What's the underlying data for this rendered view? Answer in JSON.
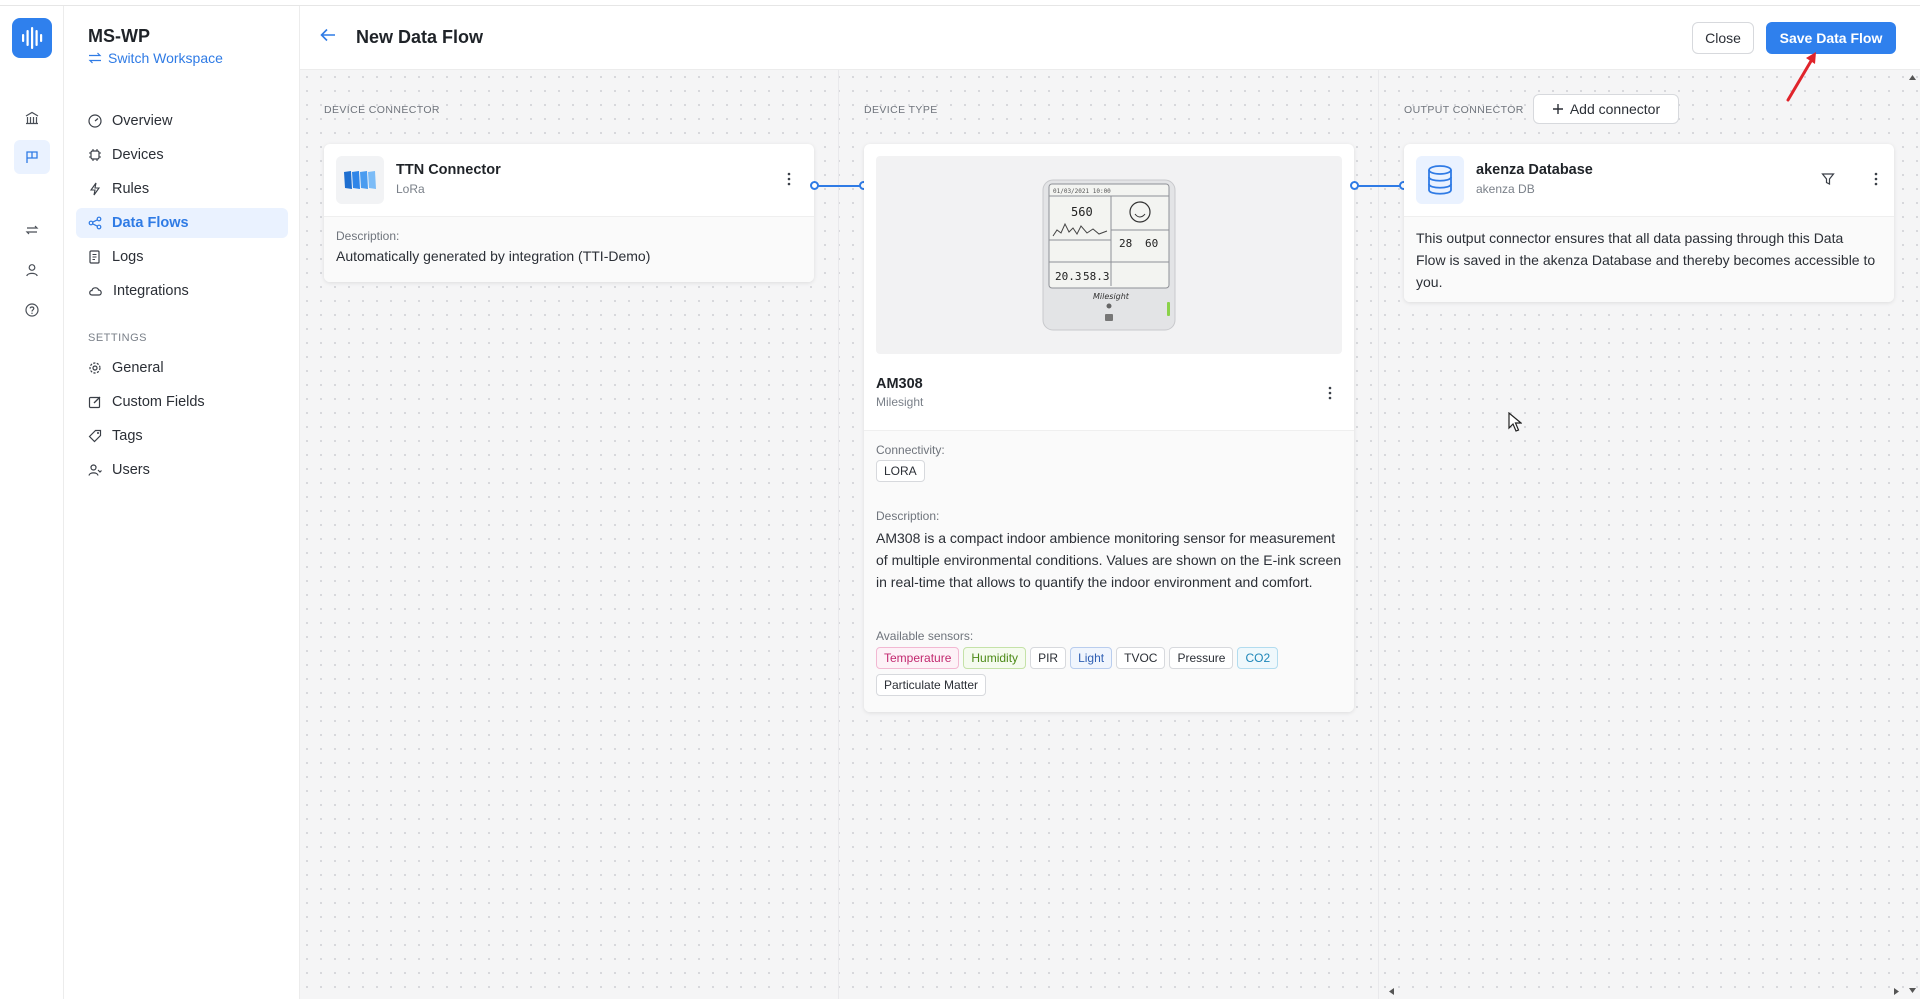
{
  "workspace": {
    "name": "MS-WP",
    "switch_label": "Switch Workspace"
  },
  "nav": {
    "items": [
      {
        "label": "Overview",
        "icon": "gauge-icon"
      },
      {
        "label": "Devices",
        "icon": "chip-icon"
      },
      {
        "label": "Rules",
        "icon": "bolt-icon"
      },
      {
        "label": "Data Flows",
        "icon": "share-icon",
        "active": true
      },
      {
        "label": "Logs",
        "icon": "log-icon"
      },
      {
        "label": "Integrations",
        "icon": "cloud-icon"
      }
    ],
    "settings_title": "SETTINGS",
    "settings_items": [
      {
        "label": "General",
        "icon": "gear-icon"
      },
      {
        "label": "Custom Fields",
        "icon": "edit-icon"
      },
      {
        "label": "Tags",
        "icon": "tag-icon"
      },
      {
        "label": "Users",
        "icon": "users-icon"
      }
    ]
  },
  "header": {
    "title": "New Data Flow",
    "close_label": "Close",
    "save_label": "Save Data Flow"
  },
  "columns": {
    "device_connector": "DEVICE CONNECTOR",
    "device_type": "DEVICE TYPE",
    "output_connector": "OUTPUT CONNECTOR",
    "add_connector_label": "Add connector"
  },
  "ttn_card": {
    "title": "TTN Connector",
    "subtitle": "LoRa",
    "description_label": "Description:",
    "description": "Automatically generated by integration (TTI-Demo)"
  },
  "device_card": {
    "title": "AM308",
    "subtitle": "Milesight",
    "connectivity_label": "Connectivity:",
    "connectivity": "LORA",
    "description_label": "Description:",
    "description": "AM308 is a compact indoor ambience monitoring sensor for measurement of multiple environmental conditions. Values are shown on the E-ink screen in real-time that allows to quantify the indoor environment and comfort.",
    "sensors_label": "Available sensors:",
    "sensors": [
      "Temperature",
      "Humidity",
      "PIR",
      "Light",
      "TVOC",
      "Pressure",
      "CO2",
      "Particulate Matter"
    ],
    "screen": {
      "date": "01/03/2021 10:00",
      "co2": "560",
      "pm": "28",
      "pm10": "60",
      "temp": "20.3",
      "hum": "58.3",
      "brand": "Milesight"
    }
  },
  "db_card": {
    "title": "akenza Database",
    "subtitle": "akenza DB",
    "description": "This output connector ensures that all data passing through this Data Flow is saved in the akenza Database and thereby becomes accessible to you."
  },
  "colors": {
    "accent": "#2f80ed",
    "active_bg": "#eaf2ff",
    "annotation_arrow": "#e0242b"
  }
}
